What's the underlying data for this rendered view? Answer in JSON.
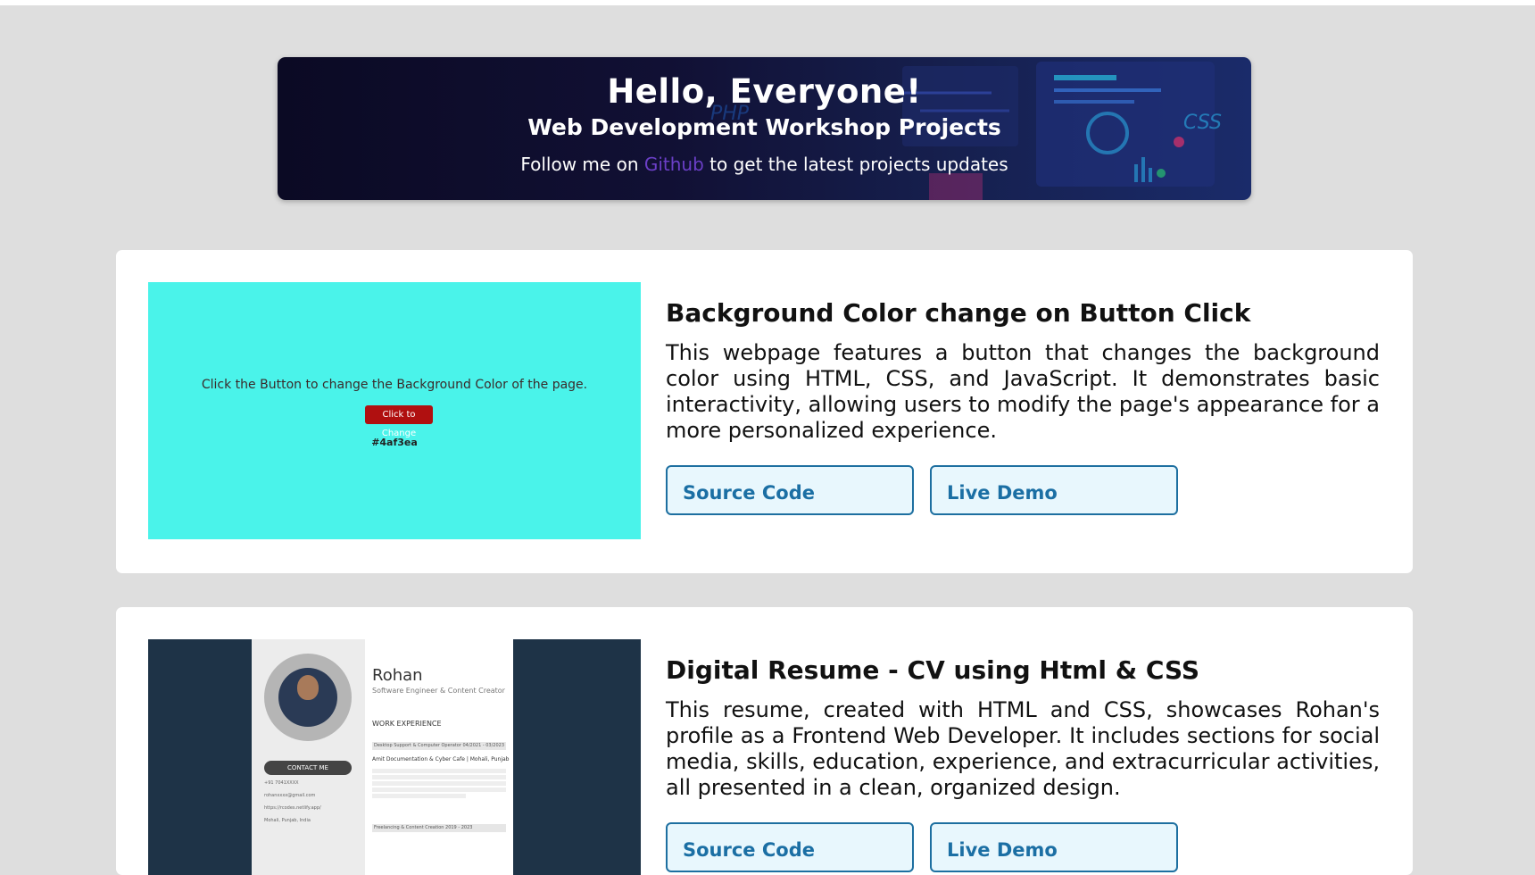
{
  "header": {
    "greeting": "Hello, Everyone!",
    "title": "Web Development Workshop Projects",
    "follow_prefix": "Follow me on ",
    "follow_link": "Github",
    "follow_suffix": " to get the latest projects updates"
  },
  "projects": [
    {
      "title": "Background Color change on Button Click",
      "description": "This webpage features a button that changes the background color using HTML, CSS, and JavaScript. It demonstrates basic interactivity, allowing users to modify the page's appearance for a more personalized experience.",
      "source_label": "Source Code",
      "demo_label": "Live Demo",
      "thumb": {
        "message": "Click the Button to change the Background Color of the page.",
        "button": "Click to Change",
        "hex": "#4af3ea",
        "bg_color": "#4af3ea"
      }
    },
    {
      "title": "Digital Resume - CV using Html & CSS",
      "description": "This resume, created with HTML and CSS, showcases Rohan's profile as a Frontend Web Developer. It includes sections for social media, skills, education, experience, and extracurricular activities, all presented in a clean, organized design.",
      "source_label": "Source Code",
      "demo_label": "Live Demo",
      "thumb": {
        "name": "Rohan",
        "subtitle": "Software Engineer & Content Creator",
        "contact": "CONTACT ME",
        "work_heading": "WORK EXPERIENCE",
        "job1": "Desktop Support & Computer Operator",
        "job1_dates": "04/2021 - 03/2023",
        "company": "Amit Documentation & Cyber Cafe | Mohali, Punjab",
        "job2": "Freelancing & Content Creation",
        "job2_dates": "2019 - 2023",
        "c1": "+91 7041XXXX",
        "c2": "rohanxxxx@gmail.com",
        "c3": "https://rcodes.netlify.app/",
        "c4": "Mohali, Punjab, India"
      }
    }
  ],
  "colors": {
    "accent": "#1b6fa4",
    "button_bg": "#e8f7fd",
    "link": "#6b3fc7"
  }
}
